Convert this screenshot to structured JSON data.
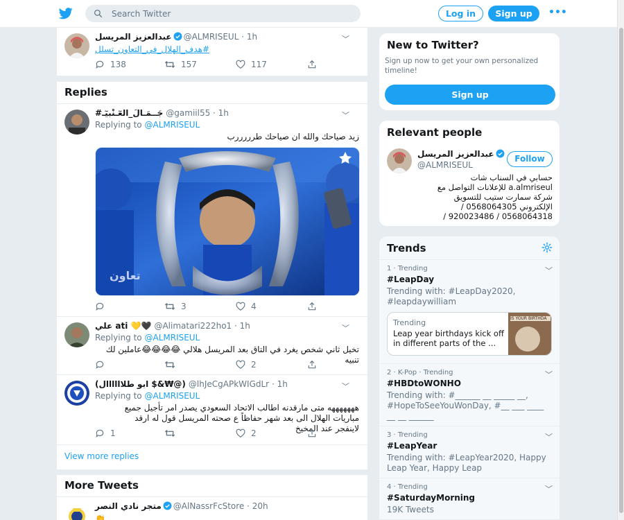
{
  "header": {
    "search_placeholder": "Search Twitter",
    "login_label": "Log in",
    "signup_label": "Sign up",
    "more_label": "•••"
  },
  "colors": {
    "accent": "#1da1f2",
    "background": "#e6ecf0",
    "text": "#14171a",
    "secondary": "#657786"
  },
  "main_tweet": {
    "name": "عبدالعزيز المريسل",
    "handle": "@ALMRISEUL",
    "time": "1h",
    "text": "#هدف_الهلال_في_التعاون_تسلل",
    "replies": "138",
    "retweets": "157",
    "likes": "117"
  },
  "replies_section": {
    "heading": "Replies",
    "items": [
      {
        "name": "#جَــمَـالَ_العٓـنْبيٓـ",
        "handle": "@gamiil55",
        "time": "1h",
        "replying_prefix": "Replying to",
        "replying_to": "@ALMRISEUL",
        "text": "زيد صياحك والله ان صياحك طرررررب",
        "replies": "",
        "retweets": "3",
        "likes": "4"
      },
      {
        "name": "علي ati 💛🖤",
        "handle": "@Alimatari222ho1",
        "time": "1h",
        "replying_prefix": "Replying to",
        "replying_to": "@ALMRISEUL",
        "text": "تخيل ثاني شخص يغرد في التاق بعد المريسل هلالي 😂😂😂😂عاملين لك تنبيه",
        "replies": "",
        "retweets": "",
        "likes": "2"
      },
      {
        "name": "(ابو طلاااااال $&₩@)",
        "handle": "@lhJeCgAPkWIGdLr",
        "time": "1h",
        "replying_prefix": "Replying to",
        "replying_to": "@ALMRISEUL",
        "text": "هههههههه متى مارقدنه اطالب الاتحاد السعودي يصدر امر تأجيل جميع مباريات الهلال الى بعد شهر حفاظاً ع صحته المريسل قول له ارقد لاينفجر عند المخيخ",
        "replies": "1",
        "retweets": "",
        "likes": "2"
      }
    ],
    "view_more": "View more replies"
  },
  "more_tweets": {
    "heading": "More Tweets",
    "first": {
      "name": "متجر نادي النصر",
      "handle": "@AlNassrFcStore",
      "time": "20h"
    }
  },
  "sidebar": {
    "new_to_twitter": {
      "title": "New to Twitter?",
      "subtitle": "Sign up now to get your own personalized timeline!",
      "signup_label": "Sign up"
    },
    "relevant_people": {
      "title": "Relevant people",
      "name": "عبدالعزيز المريسل",
      "handle": "@ALMRISEUL",
      "follow_label": "Follow",
      "bio": "حسابي في السناب شات a.almriseul للإعلانات التواصل مع شركة سمارت ستيب للتسويق الإلكتروني 0568064305 / 0568064318 / 920023486 /"
    },
    "trends": {
      "title": "Trends",
      "items": [
        {
          "meta": "1 · Trending",
          "title": "#LeapDay",
          "desc": "Trending with: #LeapDay2020, #leapdaywilliam"
        },
        {
          "meta": "2 · K-Pop · Trending",
          "title": "#HBDtoWONHO",
          "desc": "Trending with: #______ __ _____ __, #HopeToSeeYouWonDay, #__ ___ ____ __ __ ______"
        },
        {
          "meta": "3 · Trending",
          "title": "#LeapYear",
          "desc": "Trending with: #LeapYear2020, Happy Leap Year, Happy Leap"
        },
        {
          "meta": "4 · Trending",
          "title": "#SaturdayMorning",
          "desc": "19K Tweets"
        }
      ],
      "moment": {
        "label": "Trending",
        "text": "Leap year birthdays kick off in different parts of the ...",
        "thumb_text": "IS YOUR BIRTHDA"
      }
    }
  }
}
